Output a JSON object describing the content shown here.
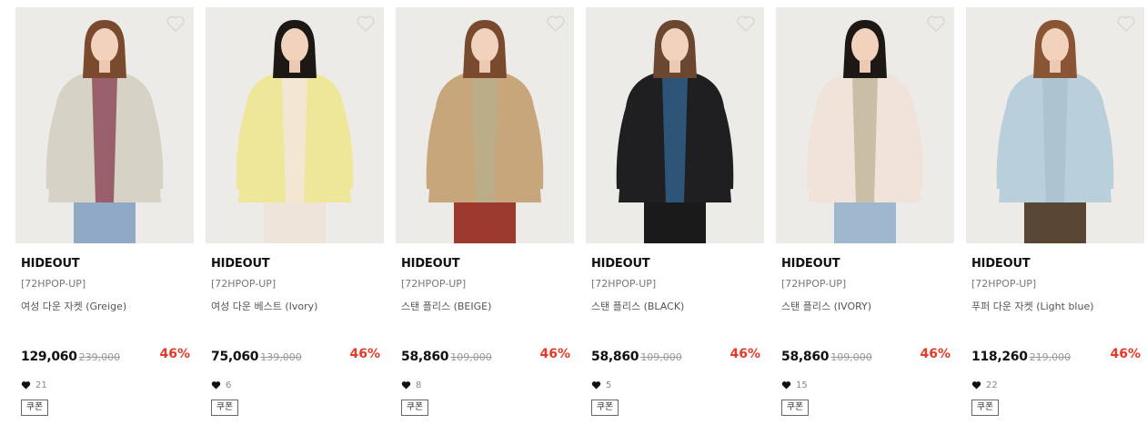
{
  "colors": {
    "discount": "#e53a2a",
    "photo_bg": "#f1efec"
  },
  "icons": {
    "wishlist": "heart-outline-icon",
    "likes": "heart-filled-icon"
  },
  "products": [
    {
      "brand": "HIDEOUT",
      "code": "[72HPOP-UP]",
      "name": "여성 다운 자켓 (Greige)",
      "price": "129,060",
      "original_price": "239,000",
      "discount": "46%",
      "likes": "21",
      "coupon": "쿠폰",
      "jacket_color": "#d6d2c6",
      "inner_color": "#8e4b5b",
      "hair_color": "#7a4a2e",
      "pants_color": "#8fa9c6"
    },
    {
      "brand": "HIDEOUT",
      "code": "[72HPOP-UP]",
      "name": "여성 다운 베스트 (Ivory)",
      "price": "75,060",
      "original_price": "139,000",
      "discount": "46%",
      "likes": "6",
      "coupon": "쿠폰",
      "jacket_color": "#eee79a",
      "inner_color": "#f1e6dc",
      "hair_color": "#1d1814",
      "pants_color": "#efe4da"
    },
    {
      "brand": "HIDEOUT",
      "code": "[72HPOP-UP]",
      "name": "스탠 플리스 (BEIGE)",
      "price": "58,860",
      "original_price": "109,000",
      "discount": "46%",
      "likes": "8",
      "coupon": "쿠폰",
      "jacket_color": "#c7a67c",
      "inner_color": "#b8ae8a",
      "hair_color": "#7a4a2e",
      "pants_color": "#9c3a2e"
    },
    {
      "brand": "HIDEOUT",
      "code": "[72HPOP-UP]",
      "name": "스탠 플리스 (BLACK)",
      "price": "58,860",
      "original_price": "109,000",
      "discount": "46%",
      "likes": "5",
      "coupon": "쿠폰",
      "jacket_color": "#1f1f21",
      "inner_color": "#2f5f86",
      "hair_color": "#6b4630",
      "pants_color": "#1a1a1a"
    },
    {
      "brand": "HIDEOUT",
      "code": "[72HPOP-UP]",
      "name": "스탠 플리스 (IVORY)",
      "price": "58,860",
      "original_price": "109,000",
      "discount": "46%",
      "likes": "15",
      "coupon": "쿠폰",
      "jacket_color": "#efe3da",
      "inner_color": "#c3b89c",
      "hair_color": "#1d1814",
      "pants_color": "#9fb7cf"
    },
    {
      "brand": "HIDEOUT",
      "code": "[72HPOP-UP]",
      "name": "푸퍼 다운 자켓 (Light blue)",
      "price": "118,260",
      "original_price": "219,000",
      "discount": "46%",
      "likes": "22",
      "coupon": "쿠폰",
      "jacket_color": "#b9cfdb",
      "inner_color": "#a9c1cf",
      "hair_color": "#8a5534",
      "pants_color": "#5a4634"
    }
  ]
}
